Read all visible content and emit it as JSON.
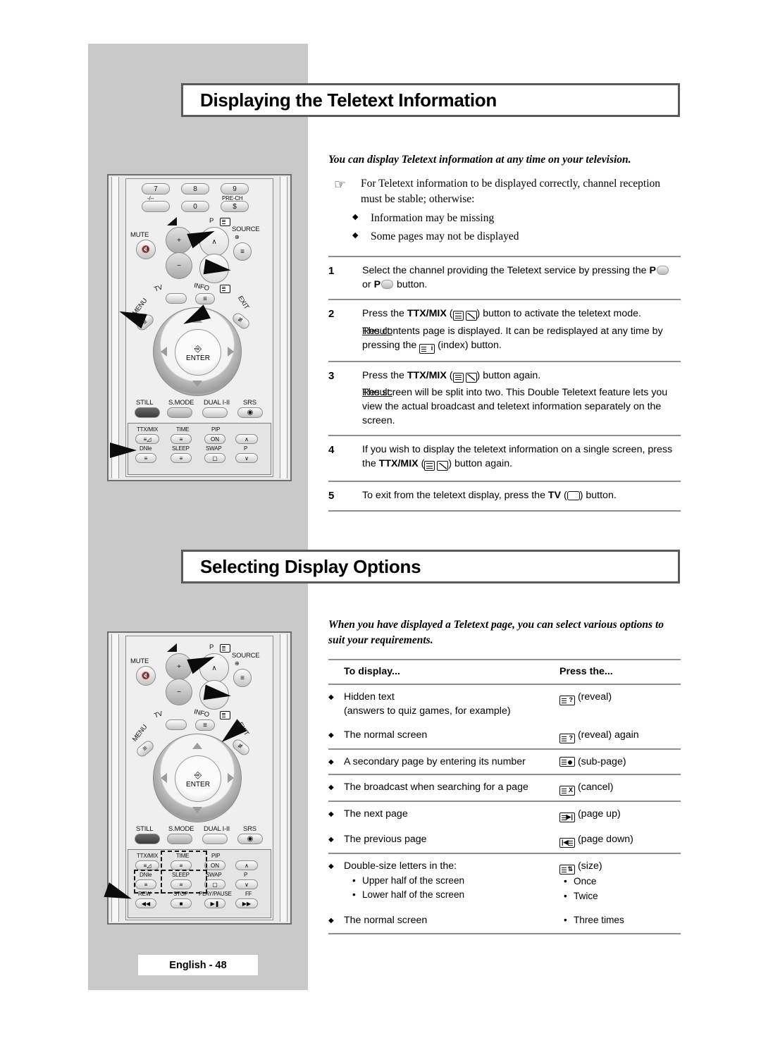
{
  "page": {
    "footer_label": "English - 48",
    "background": "#ffffff",
    "panel_color": "#c8c8c8"
  },
  "section1": {
    "title": "Displaying the Teletext Information",
    "lead": "You can display Teletext information at any time on your television.",
    "note": {
      "icon": "pointing-hand-icon",
      "text": "For Teletext information to be displayed correctly, channel reception must be stable; otherwise:",
      "bullets": [
        "Information may be missing",
        "Some pages may not be displayed"
      ]
    },
    "steps": [
      {
        "num": "1",
        "text_before": "Select the channel providing the Teletext service by pressing the ",
        "text_after": " button.",
        "key_bold_1": "P",
        "key_bold_2": "P",
        "middle": " or ",
        "result_label": null,
        "result_text": null
      },
      {
        "num": "2",
        "text_before": "Press the ",
        "key_bold": "TTX/MIX",
        "text_after": " button to activate the teletext mode.",
        "result_label": "Result:",
        "result_text": "The contents page is displayed. It can be redisplayed at any time by pressing the ",
        "result_text_after": " (index) button."
      },
      {
        "num": "3",
        "text_before": "Press the ",
        "key_bold": "TTX/MIX",
        "text_after": " button again.",
        "result_label": "Result:",
        "result_text": "The screen will be split into two. This Double Teletext feature lets you view the actual broadcast and teletext information separately on the screen."
      },
      {
        "num": "4",
        "text_before": "If you wish to display the teletext information on a single screen, press the ",
        "key_bold": "TTX/MIX",
        "text_after": " button again."
      },
      {
        "num": "5",
        "text_before": "To exit from the teletext display, press the ",
        "key_bold": "TV",
        "text_after": " button."
      }
    ]
  },
  "section2": {
    "title": "Selecting Display Options",
    "lead": "When you have displayed a Teletext page, you can select various options to suit your requirements.",
    "table": {
      "headers": [
        "To display...",
        "Press the..."
      ],
      "rows": [
        {
          "display": "Hidden text",
          "display_sub": "(answers to quiz games, for example)",
          "press_icon": "reveal-icon",
          "press": "(reveal)"
        },
        {
          "display": "The normal screen",
          "press_icon": "reveal-icon",
          "press": "(reveal) again"
        },
        {
          "display": "A secondary page by entering its number",
          "press_icon": "sub-page-icon",
          "press": "(sub-page)"
        },
        {
          "display": "The broadcast when searching for a page",
          "press_icon": "cancel-icon",
          "press": "(cancel)"
        },
        {
          "display": "The next page",
          "press_icon": "page-up-icon",
          "press": "(page up)"
        },
        {
          "display": "The previous page",
          "press_icon": "page-down-icon",
          "press": "(page down)"
        },
        {
          "display": "Double-size letters in the:",
          "display_dots": [
            "Upper half of the screen",
            "Lower half of the screen"
          ],
          "press_icon": "size-icon",
          "press": "(size)",
          "press_dots": [
            "Once",
            "Twice"
          ]
        },
        {
          "display": "The normal screen",
          "press_dots": [
            "Three times"
          ]
        }
      ]
    }
  },
  "remote1": {
    "numpad": [
      {
        "label": "7",
        "sub": "-/--"
      },
      {
        "label": "8",
        "sub": ""
      },
      {
        "label": "9",
        "sub": "PRE-CH"
      }
    ],
    "numpad_row2": [
      "",
      "0",
      "$"
    ],
    "mute": "MUTE",
    "vol_plus": "+",
    "vol_minus": "−",
    "prog": "P",
    "source": "SOURCE",
    "tv": "TV",
    "info": "INFO",
    "menu": "MENU",
    "exit": "EXIT",
    "enter": "ENTER",
    "feature_row": [
      "STILL",
      "S.MODE",
      "DUAL I-II",
      "SRS"
    ],
    "bottom_row1": [
      "TTX/MIX",
      "TIME",
      "PIP",
      ""
    ],
    "bottom_row1_sub": [
      "",
      "",
      "ON",
      ""
    ],
    "bottom_row2": [
      "DNIe",
      "SLEEP",
      "SWAP",
      "P"
    ]
  },
  "remote2": {
    "mute": "MUTE",
    "prog": "P",
    "source": "SOURCE",
    "tv": "TV",
    "info": "INFO",
    "menu": "MENU",
    "exit": "EXIT",
    "enter": "ENTER",
    "feature_row": [
      "STILL",
      "S.MODE",
      "DUAL I-II",
      "SRS"
    ],
    "bottom_row1": [
      "TTX/MIX",
      "TIME",
      "PIP",
      ""
    ],
    "bottom_row1_sub": [
      "",
      "",
      "ON",
      ""
    ],
    "bottom_row2": [
      "DNIe",
      "SLEEP",
      "SWAP",
      "P"
    ],
    "bottom_row3": [
      "REW",
      "STOP",
      "PLAY/PAUSE",
      "FF"
    ]
  }
}
